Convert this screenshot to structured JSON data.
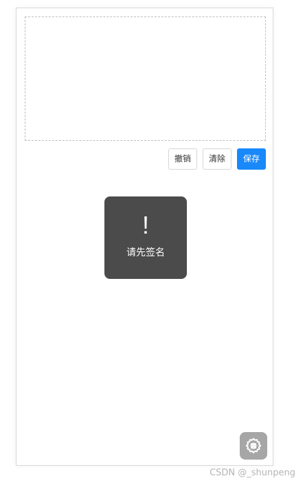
{
  "signature_pad": {
    "border_style": "dashed",
    "border_color": "#bdbdbd"
  },
  "actions": {
    "undo_label": "撤销",
    "clear_label": "清除",
    "save_label": "保存",
    "save_color": "#1989fa"
  },
  "toast": {
    "icon": "exclamation-icon",
    "icon_glyph": "!",
    "message": "请先签名"
  },
  "floating_button": {
    "icon": "gear-icon"
  },
  "watermark": {
    "text": "CSDN @_shunpeng"
  }
}
